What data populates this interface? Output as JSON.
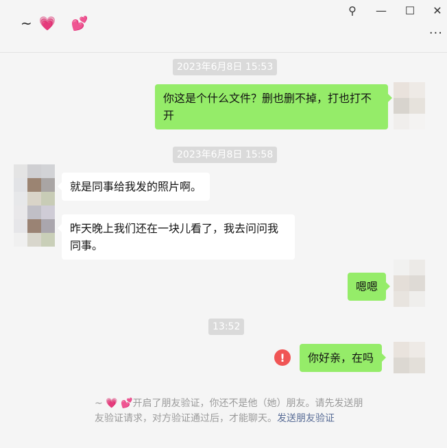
{
  "header": {
    "chat_name": "~",
    "heart1": "💗",
    "heart2": "💕",
    "pin": "⚲",
    "minimize": "—",
    "maximize": "☐",
    "close": "✕",
    "more": "···"
  },
  "messages": [
    {
      "type": "timestamp",
      "text": "2023年6月8日 15:53"
    },
    {
      "type": "sent",
      "text": "你这是个什么文件？删也删不掉，打也打不开"
    },
    {
      "type": "timestamp",
      "text": "2023年6月8日 15:58"
    },
    {
      "type": "received",
      "text": "就是同事给我发的照片啊。"
    },
    {
      "type": "received",
      "text": "昨天晚上我们还在一块儿看了，我去问问我同事。"
    },
    {
      "type": "sent",
      "text": "嗯嗯"
    },
    {
      "type": "timestamp",
      "text": "13:52"
    },
    {
      "type": "sent",
      "text": "你好亲，在吗",
      "failed": true,
      "error_symbol": "!"
    }
  ],
  "system_message": {
    "prefix": "~ 💗 💕开启了朋友验证，你还不是他（她）朋友。请先发送朋友验证请求，对方验证通过后，才能聊天。",
    "link": "发送朋友验证"
  },
  "colors": {
    "sent_bubble": "#95ec69",
    "received_bubble": "#ffffff",
    "background": "#f5f5f5",
    "error": "#f05555",
    "link": "#576b95"
  }
}
